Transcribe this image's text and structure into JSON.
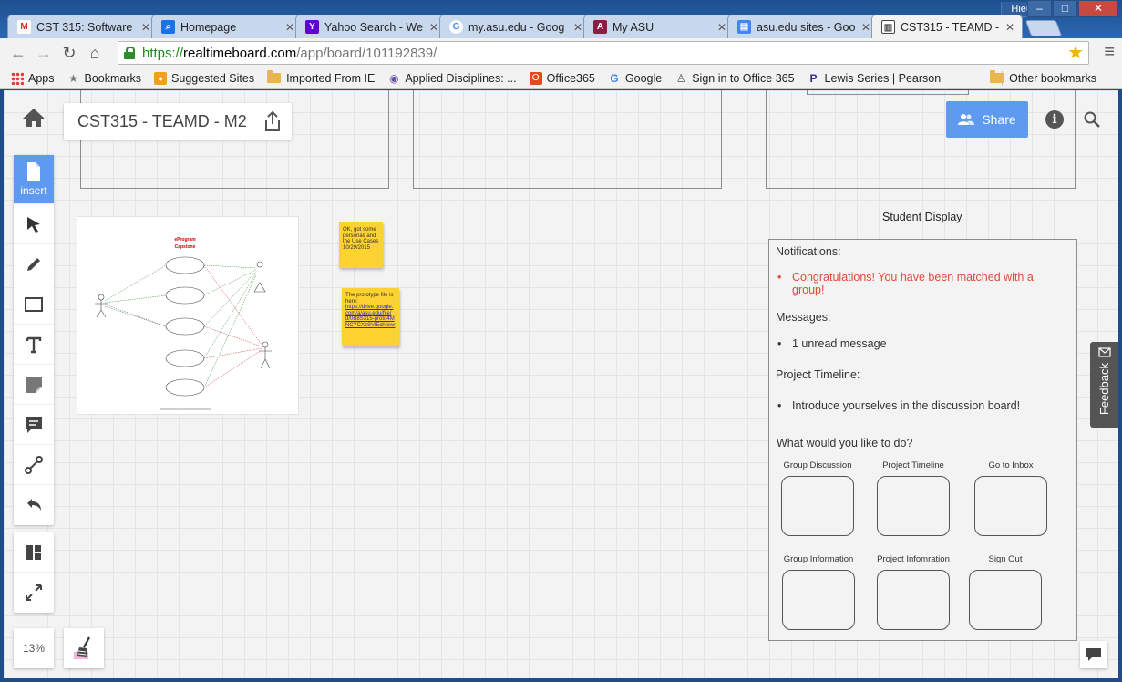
{
  "window": {
    "user": "Hieu",
    "min": "‒",
    "max": "□",
    "close": "✕"
  },
  "tabs": [
    {
      "title": "CST 315: Software",
      "icon": "gmail-icon",
      "color": "#d93025",
      "glyph": "M"
    },
    {
      "title": "Homepage",
      "icon": "search-icon",
      "color": "#1a73e8",
      "glyph": "⌕"
    },
    {
      "title": "Yahoo Search - We",
      "icon": "yahoo-icon",
      "color": "#5f01d1",
      "glyph": "Y"
    },
    {
      "title": "my.asu.edu - Goog",
      "icon": "google-icon",
      "color": "#ffffff",
      "glyph": "G"
    },
    {
      "title": "My ASU",
      "icon": "asu-icon",
      "color": "#8c1d40",
      "glyph": "A"
    },
    {
      "title": "asu.edu sites - Goo",
      "icon": "sites-icon",
      "color": "#4285f4",
      "glyph": "▤"
    },
    {
      "title": "CST315 - TEAMD -",
      "icon": "board-icon",
      "color": "#444444",
      "glyph": "▥"
    }
  ],
  "address": {
    "scheme": "https://",
    "host": "realtimeboard.com",
    "path": "/app/board/101192839/"
  },
  "bookmarks": [
    {
      "label": "Apps",
      "icon": "apps-icon"
    },
    {
      "label": "Bookmarks",
      "icon": "star-icon"
    },
    {
      "label": "Suggested Sites",
      "icon": "suggested-icon"
    },
    {
      "label": "Imported From IE",
      "icon": "folder-icon"
    },
    {
      "label": "Applied Disciplines: ...",
      "icon": "owl-icon"
    },
    {
      "label": "Office365",
      "icon": "office-icon"
    },
    {
      "label": "Google",
      "icon": "google-icon"
    },
    {
      "label": "Sign in to Office 365",
      "icon": "signin-icon"
    },
    {
      "label": "Lewis Series | Pearson",
      "icon": "pearson-icon"
    }
  ],
  "bookmarks_more": "»",
  "other_bookmarks": "Other bookmarks",
  "board": {
    "title": "CST315 - TEAMD - M2",
    "share_label": "Share",
    "info_glyph": "i",
    "insert_label": "insert",
    "zoom": "13%",
    "feedback_label": "Feedback"
  },
  "diagram": {
    "title_line1": "eProgram",
    "title_line2": "Capstone"
  },
  "sticky1": {
    "text": "OK, got some personas and the Use Cases 10/29/2015"
  },
  "sticky2": {
    "text": "The prototype file is here:",
    "link": "https://drive.google.com/a/asu.edu/file/d/0B8S315-proto4MNCYCXzSVlEd/view"
  },
  "student": {
    "title": "Student Display",
    "notifications_label": "Notifications:",
    "notification": "Congratulations! You have been matched with a group!",
    "messages_label": "Messages:",
    "message": "1 unread message",
    "timeline_label": "Project Timeline:",
    "timeline_item": "Introduce yourselves in the discussion board!",
    "actions_label": "What would you like to do?",
    "actions": [
      "Group Discussion",
      "Project Timeline",
      "Go to Inbox",
      "Group Information",
      "Project Infomration",
      "Sign Out"
    ]
  }
}
